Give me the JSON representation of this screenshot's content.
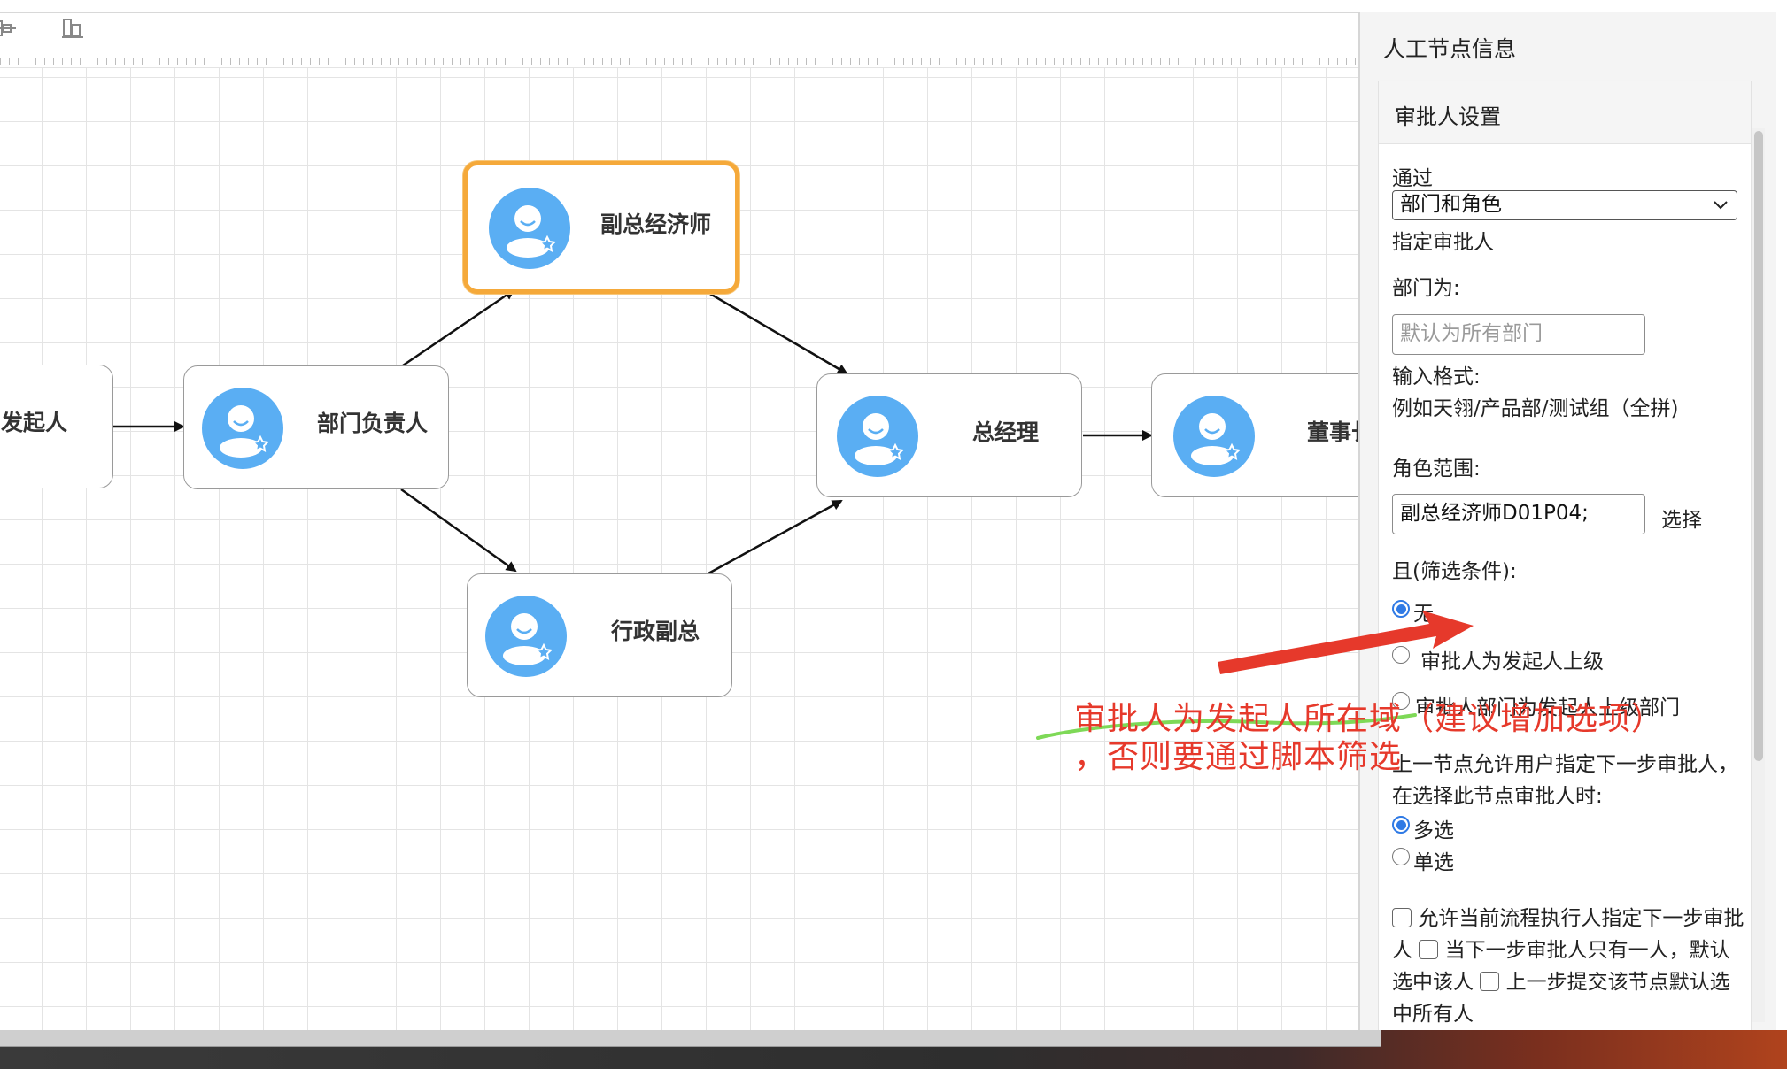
{
  "panel": {
    "title": "人工节点信息",
    "section_title": "审批人设置",
    "via_label": "通过",
    "via_value": "部门和角色",
    "assign_label": "指定审批人",
    "dept_label": "部门为:",
    "dept_placeholder": "默认为所有部门",
    "format_label": "输入格式:",
    "format_example": "例如天翎/产品部/测试组（全拼)",
    "role_label": "角色范围:",
    "role_value": "副总经济师D01P04;",
    "role_select_button": "选择",
    "filter_label": "且(筛选条件):",
    "filter_options": [
      {
        "label": "无",
        "selected": true
      },
      {
        "label": "审批人为发起人上级",
        "selected": false
      },
      {
        "label": "审批人部门为发起人上级部门",
        "selected": false
      }
    ],
    "prev_node_note": "上一节点允许用户指定下一步审批人，在选择此节点审批人时:",
    "select_mode_options": [
      {
        "label": "多选",
        "selected": true
      },
      {
        "label": "单选",
        "selected": false
      }
    ],
    "checkbox_options": [
      {
        "label": "允许当前流程执行人指定下一步审批人",
        "checked": false
      },
      {
        "label": "当下一步审批人只有一人，默认选中该人",
        "checked": false
      },
      {
        "label": "上一步提交该节点默认选中所有人",
        "checked": false
      }
    ]
  },
  "flow": {
    "nodes": [
      {
        "id": "start",
        "label": "发起人"
      },
      {
        "id": "dept_head",
        "label": "部门负责人"
      },
      {
        "id": "deputy_economist",
        "label": "副总经济师",
        "selected": true
      },
      {
        "id": "admin_deputy",
        "label": "行政副总"
      },
      {
        "id": "gm",
        "label": "总经理"
      },
      {
        "id": "board",
        "label": "董事长"
      }
    ],
    "edges": [
      [
        "start",
        "dept_head"
      ],
      [
        "dept_head",
        "deputy_economist"
      ],
      [
        "dept_head",
        "admin_deputy"
      ],
      [
        "deputy_economist",
        "gm"
      ],
      [
        "admin_deputy",
        "gm"
      ],
      [
        "gm",
        "board"
      ]
    ]
  },
  "annotation": {
    "line1": "审批人为发起人所在域（建议增加选项）",
    "line2": "，否则要通过脚本筛选",
    "colors": {
      "text": "#e6392b",
      "arrow": "#e6392b",
      "underline": "#7ed957"
    }
  },
  "colors": {
    "selected_border": "#f5a93a",
    "avatar_blue": "#5aaef3",
    "radio_blue": "#2f7ae5"
  }
}
